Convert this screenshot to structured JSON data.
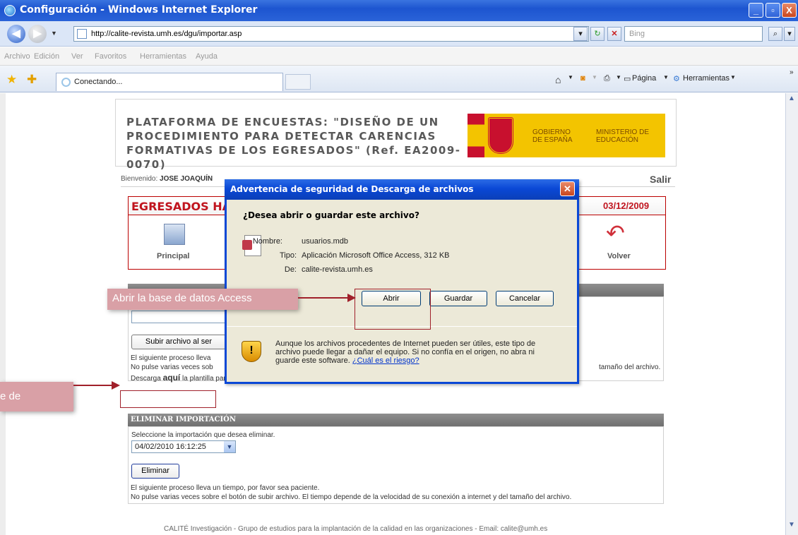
{
  "window": {
    "title": "Configuración - Windows Internet Explorer",
    "minimize": "_",
    "maximize": "▫",
    "close": "X"
  },
  "address_bar": {
    "url": "http://calite-revista.umh.es/dgu/importar.asp",
    "search_placeholder": "Bing"
  },
  "menu": [
    "Archivo",
    "Edición",
    "Ver",
    "Favoritos",
    "Herramientas",
    "Ayuda"
  ],
  "tabs": {
    "active_tab_label": "Conectando...",
    "command_page": "Página",
    "command_tools": "Herramientas",
    "overflow": "»"
  },
  "page": {
    "platform_title": "PLATAFORMA DE ENCUESTAS: \"DISEÑO DE UN PROCEDIMIENTO PARA DETECTAR CARENCIAS FORMATIVAS DE LOS EGRESADOS\" (Ref. EA2009-0070)",
    "gov_left": "GOBIERNO DE ESPAÑA",
    "gov_right": "MINISTERIO DE EDUCACIÓN",
    "welcome_label": "Bienvenido:",
    "welcome_user": "JOSE JOAQUÍN",
    "logout": "Salir",
    "banner_title": "EGRESADOS HA",
    "banner_date": "03/12/2009",
    "nav_principal": "Principal",
    "nav_volver": "Volver",
    "upload_button": "Subir archivo al ser",
    "upload_note_1": "El siguiente proceso lleva",
    "upload_note_2": "No pulse varias veces sob",
    "upload_note_tail": "tamaño del archivo.",
    "download_prefix": "Descarga",
    "download_link": "aquí",
    "download_suffix": "la plantilla para subir los datos.",
    "delete_header": "ELIMINAR IMPORTACIÓN",
    "delete_prompt": "Seleccione la importación que desea eliminar.",
    "delete_selected": "04/02/2010 16:12:25",
    "delete_button": "Eliminar",
    "delete_note_1": "El siguiente proceso lleva un tiempo, por favor sea paciente.",
    "delete_note_2": "No pulse varias veces sobre el botón de subir archivo. El tiempo depende de la velocidad de su conexión a internet y del tamaño del archivo.",
    "footer": "CALITÉ Investigación - Grupo de estudios para la implantación de la calidad en las organizaciones - Email: calite@umh.es"
  },
  "dialog": {
    "title": "Advertencia de seguridad de Descarga de archivos",
    "question": "¿Desea abrir o guardar este archivo?",
    "name_label": "Nombre:",
    "name_value": "usuarios.mdb",
    "type_label": "Tipo:",
    "type_value": "Aplicación Microsoft Office Access, 312 KB",
    "from_label": "De:",
    "from_value": "calite-revista.umh.es",
    "btn_open": "Abrir",
    "btn_save": "Guardar",
    "btn_cancel": "Cancelar",
    "warning": "Aunque los archivos procedentes de Internet pueden ser útiles, este tipo de archivo puede llegar a dañar el equipo. Si no confía en el origen, no abra ni guarde este software.",
    "risk_link": "¿Cuál es el riesgo?"
  },
  "annotations": {
    "open_db": "Abrir la base de  datos Access",
    "partial": "e de"
  }
}
